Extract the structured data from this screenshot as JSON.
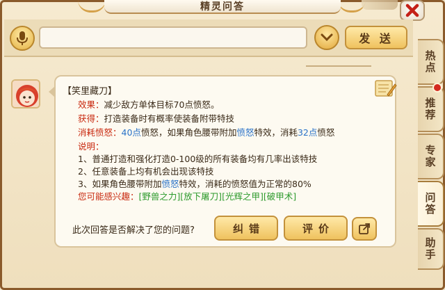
{
  "window": {
    "title": "精灵问答",
    "close_icon": "close-x-icon"
  },
  "input_bar": {
    "mic_icon": "microphone-icon",
    "search_value": "",
    "search_placeholder": "",
    "dropdown_icon": "chevron-down-icon",
    "send_label": "发 送"
  },
  "side_tabs": [
    {
      "label": "热点",
      "active": false
    },
    {
      "label": "推荐",
      "active": false,
      "has_notification": true
    },
    {
      "label": "专家",
      "active": false
    },
    {
      "label": "问答",
      "active": true
    },
    {
      "label": "助手",
      "active": false
    }
  ],
  "answer": {
    "entry_name": "【笑里藏刀】",
    "effect_label": "效果",
    "effect_text": "减少敌方单体目标70点愤怒。",
    "obtain_label": "获得",
    "obtain_text": "打造装备时有概率使装备附带特技",
    "cost_label": "消耗愤怒",
    "cost_amount": "40点",
    "cost_text_a": "愤怒，如果角色腰带附加",
    "cost_highlight": "愤怒",
    "cost_text_b": "特效，消耗",
    "cost_amount_2": "32点",
    "cost_text_c": "愤怒",
    "desc_label": "说明",
    "desc_1": "1、普通打造和强化打造0-100级的所有装备均有几率出该特技",
    "desc_2": "2、任意装备上均有机会出现该特技",
    "desc_3_a": "3、如果角色腰带附加",
    "desc_3_hl": "愤怒",
    "desc_3_b": "特效，消耗的愤怒值为正常的80%",
    "interest_label": "您可能感兴趣",
    "interest_items": [
      "[野兽之力]",
      "[放下屠刀]",
      "[光辉之甲]",
      "[破甲术]"
    ],
    "note_icon": "notebook-pencil-icon"
  },
  "feedback": {
    "question": "此次回答是否解决了您的问题?",
    "correct_label": "纠错",
    "rate_label": "评价",
    "share_icon": "share-icon"
  },
  "colors": {
    "label_red": "#c8280e",
    "link_blue": "#2a72c8",
    "interest_green": "#2c9a2c",
    "button_gold": "#efc25e",
    "frame_brown": "#8a5a2b"
  }
}
